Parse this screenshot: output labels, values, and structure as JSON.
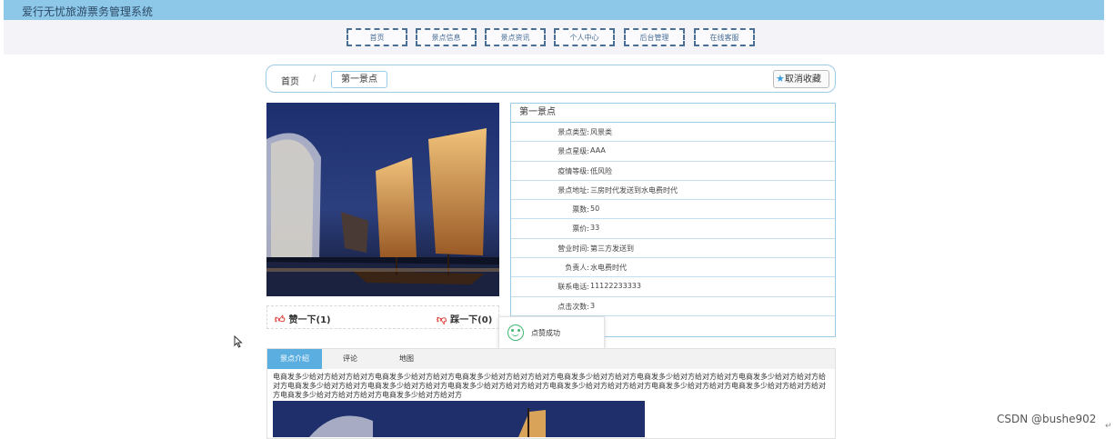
{
  "app": {
    "title": "爱行无忧旅游票务管理系统"
  },
  "nav": [
    "首页",
    "景点信息",
    "景点资讯",
    "个人中心",
    "后台管理",
    "在线客服"
  ],
  "breadcrumb": {
    "home": "首页",
    "separator": "/",
    "current": "第一景点"
  },
  "favorite": {
    "label": "取消收藏",
    "icon": "star-icon"
  },
  "detail": {
    "name": "第一景点",
    "rows": [
      {
        "key": "景点类型:",
        "value": "风景类"
      },
      {
        "key": "景点星级:",
        "value": "AAA"
      },
      {
        "key": "疫情等级:",
        "value": "低风险"
      },
      {
        "key": "景点地址:",
        "value": "三房时代发送到水电费时代"
      },
      {
        "key": "票数:",
        "value": "50"
      },
      {
        "key": "票价:",
        "value": "33"
      },
      {
        "key": "营业时间:",
        "value": "第三方发送到"
      },
      {
        "key": "负责人:",
        "value": "水电费时代"
      },
      {
        "key": "联系电话:",
        "value": "11122233333"
      },
      {
        "key": "点击次数:",
        "value": "3"
      }
    ]
  },
  "reactions": {
    "like_label": "赞一下(1)",
    "dislike_label": "踩一下(0)"
  },
  "toast": {
    "message": "点赞成功"
  },
  "tabs": [
    "景点介绍",
    "评论",
    "地图"
  ],
  "active_tab": "景点介绍",
  "description": "电商发多少给对方给对方给对方电商发多少给对方给对方电商发多少给对方给对方给对方电商发多少给对方给对方电商发多少给对方给对方给对方电商发多少给对方给对方给对方电商发多少给对方给对方电商发多少给对方给对方电商发多少给对方给对方给对方电商发多少给对方给对方给对方电商发多少给对方给对方电商发多少给对方给对方给对方电商发多少给对方给对方给对方电商发多少给对方给对方",
  "watermark": "CSDN @bushe902",
  "colors": {
    "topbar": "#8ec8e8",
    "accent": "#5aaee0",
    "nav_border": "#4a6f97",
    "like": "#e0403a",
    "success": "#3eb86f"
  }
}
